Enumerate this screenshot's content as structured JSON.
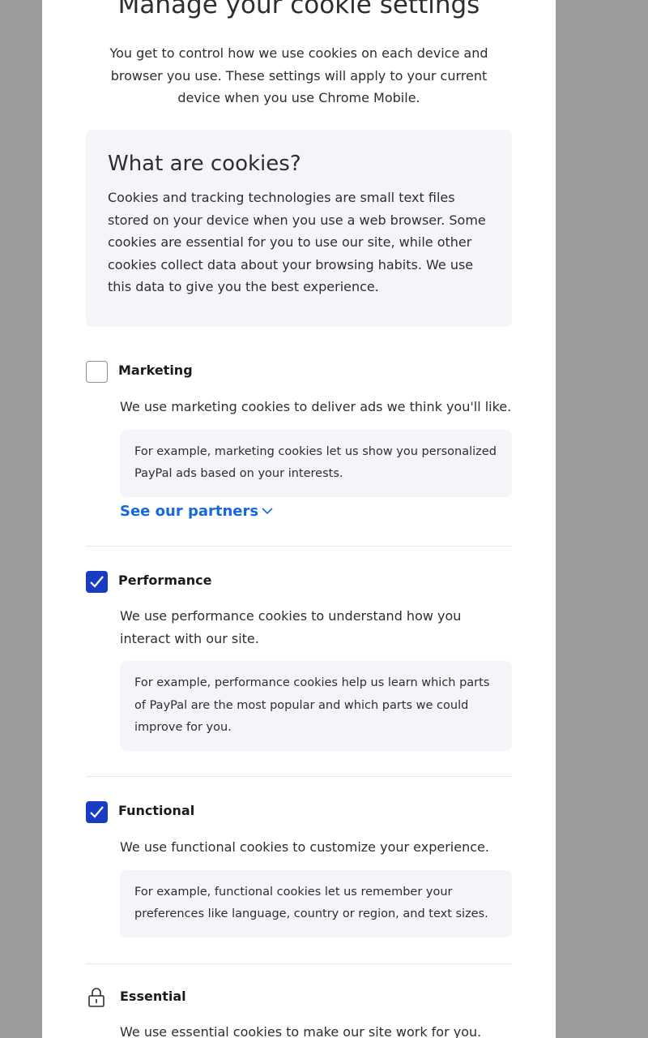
{
  "header": {
    "title": "Manage your cookie settings",
    "subtitle": "You get to control how we use cookies on each device and browser you use. These settings will apply to your current device when you use Chrome Mobile."
  },
  "info": {
    "heading": "What are cookies?",
    "body": "Cookies and tracking technologies are small text files stored on your device when you use a web browser. Some cookies are essential for you to use our site, while other cookies collect data about your browsing habits. We use this data to give you the best experience."
  },
  "categories": [
    {
      "name": "Marketing",
      "checked": false,
      "description": "We use marketing cookies to deliver ads we think you'll like.",
      "example": "For example, marketing cookies let us show you personalized PayPal ads based on your interests.",
      "link": "See our partners"
    },
    {
      "name": "Performance",
      "checked": true,
      "description": "We use performance cookies to understand how you interact with our site.",
      "example": "For example, performance cookies help us learn which parts of PayPal are the most popular and which parts we could improve for you."
    },
    {
      "name": "Functional",
      "checked": true,
      "description": "We use functional cookies to customize your experience.",
      "example": "For example, functional cookies let us remember your preferences like language, country or region, and text sizes."
    },
    {
      "name": "Essential",
      "icon": "lock-icon",
      "description": "We use essential cookies to make our site work for you."
    }
  ],
  "colors": {
    "accent": "#1a3cc3",
    "link": "#1769d6",
    "box": "#f4f5f9",
    "overlay": "#9c9c9c"
  }
}
